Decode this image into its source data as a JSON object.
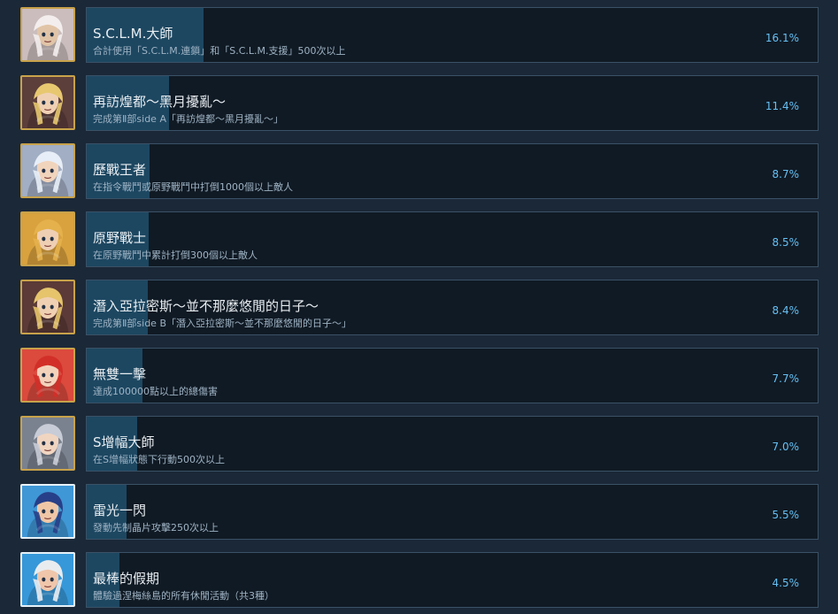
{
  "achievements": [
    {
      "title": "S.C.L.M.大師",
      "description": "合計使用「S.C.L.M.連鎖」和「S.C.L.M.支援」500次以上",
      "percent_label": "16.1%",
      "percent": 16.1,
      "icon": "sclm-master-icon",
      "frame_color": "#c8a24a",
      "bg_color": "#c7b8b8",
      "hair_color": "#f3eded",
      "skin_color": "#e1c4a7"
    },
    {
      "title": "再訪煌都～黑月擾亂～",
      "description": "完成第Ⅱ部side A「再訪煌都～黑月擾亂～」",
      "percent_label": "11.4%",
      "percent": 11.4,
      "icon": "revisit-capital-icon",
      "frame_color": "#c8a24a",
      "bg_color": "#4f2e2b",
      "hair_color": "#e7c870",
      "skin_color": "#f0d0b3"
    },
    {
      "title": "歷戰王者",
      "description": "在指令戰鬥或原野戰鬥中打倒1000個以上敵人",
      "percent_label": "8.7%",
      "percent": 8.7,
      "icon": "battle-king-icon",
      "frame_color": "#c8a24a",
      "bg_color": "#9aa8bf",
      "hair_color": "#e8eef7",
      "skin_color": "#f1d4bc"
    },
    {
      "title": "原野戰士",
      "description": "在原野戰鬥中累計打倒300個以上敵人",
      "percent_label": "8.5%",
      "percent": 8.5,
      "icon": "field-warrior-icon",
      "frame_color": "#c8a24a",
      "bg_color": "#d69b2e",
      "hair_color": "#e4b14c",
      "skin_color": "#efcfb3"
    },
    {
      "title": "潛入亞拉密斯～並不那麼悠閒的日子～",
      "description": "完成第Ⅱ部side B「潛入亞拉密斯～並不那麼悠閒的日子～」",
      "percent_label": "8.4%",
      "percent": 8.4,
      "icon": "infiltrate-aramis-icon",
      "frame_color": "#c8a24a",
      "bg_color": "#4e2a26",
      "hair_color": "#e5c46c",
      "skin_color": "#f0d0b2"
    },
    {
      "title": "無雙一擊",
      "description": "達成100000點以上的總傷害",
      "percent_label": "7.7%",
      "percent": 7.7,
      "icon": "peerless-strike-icon",
      "frame_color": "#c8a24a",
      "bg_color": "#d83b2d",
      "hair_color": "#d22f28",
      "skin_color": "#f3d2bb"
    },
    {
      "title": "S增幅大師",
      "description": "在S增幅狀態下行動500次以上",
      "percent_label": "7.0%",
      "percent": 7.0,
      "icon": "s-boost-master-icon",
      "frame_color": "#c8a24a",
      "bg_color": "#6f7886",
      "hair_color": "#c8ccd6",
      "skin_color": "#f0d5c1"
    },
    {
      "title": "雷光一閃",
      "description": "發動先制晶片攻擊250次以上",
      "percent_label": "5.5%",
      "percent": 5.5,
      "icon": "lightning-flash-icon",
      "frame_color": "#e7f1f8",
      "bg_color": "#2f8fd2",
      "hair_color": "#273f88",
      "skin_color": "#efc7a7"
    },
    {
      "title": "最棒的假期",
      "description": "體驗過涅梅絲島的所有休閒活動（共3種）",
      "percent_label": "4.5%",
      "percent": 4.5,
      "icon": "best-vacation-icon",
      "frame_color": "#e7f1f8",
      "bg_color": "#2590d6",
      "hair_color": "#e9ecef",
      "skin_color": "#f0c6ab"
    }
  ]
}
